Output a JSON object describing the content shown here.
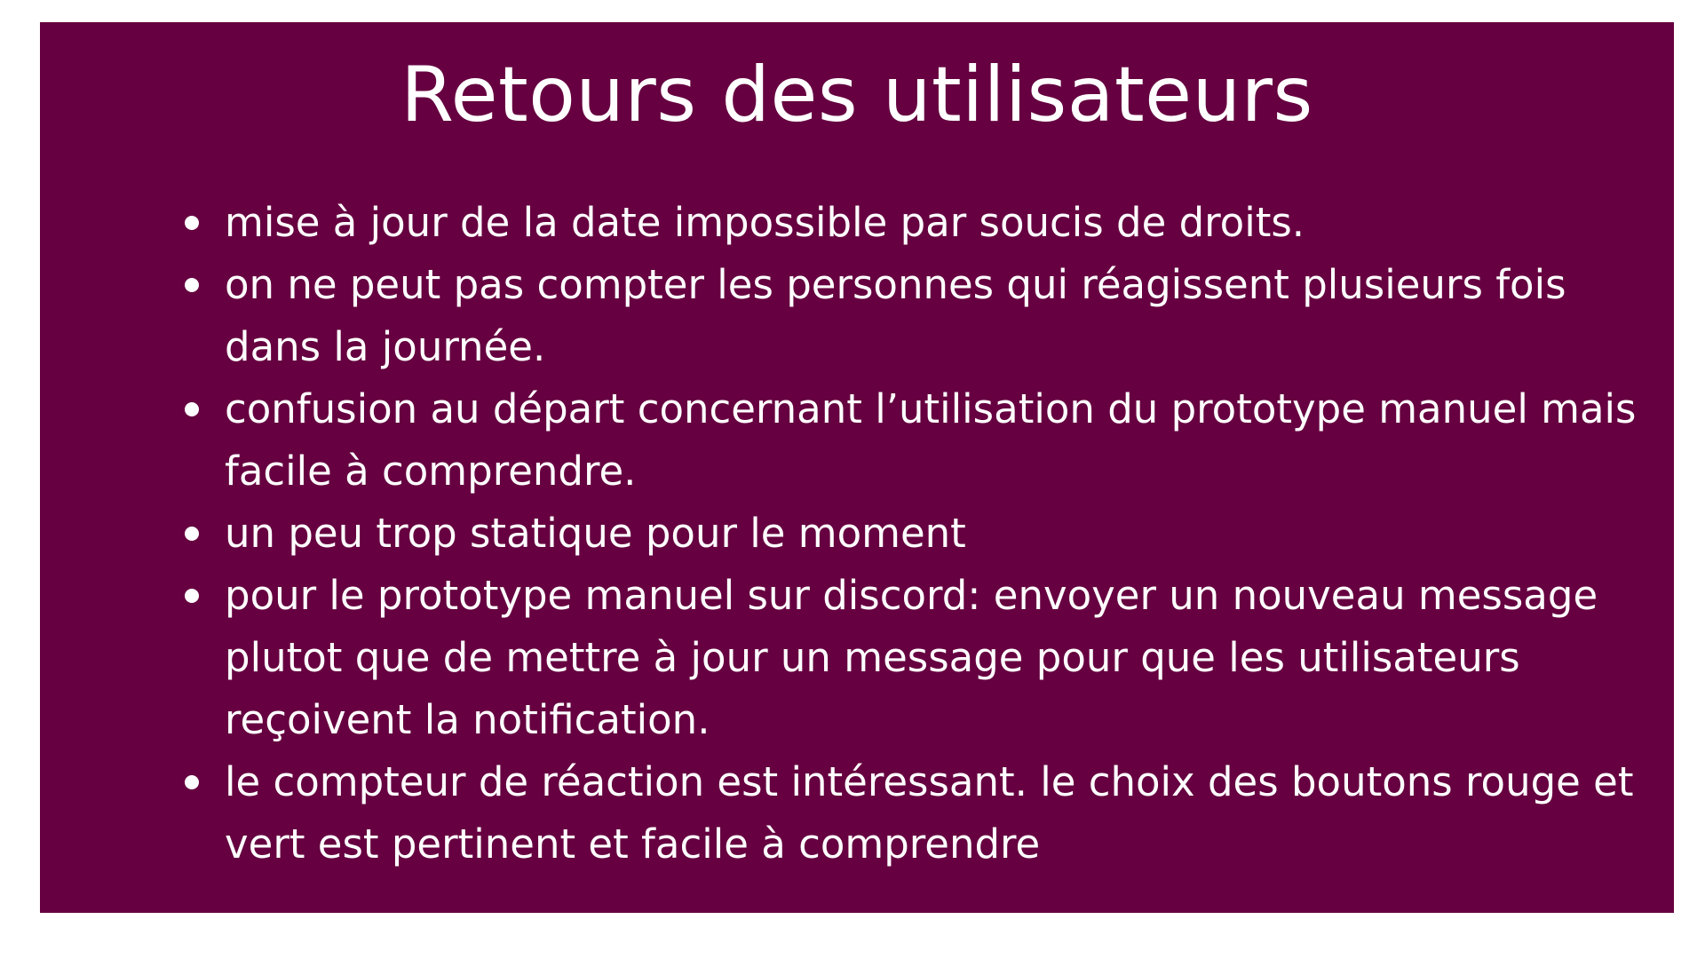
{
  "slide": {
    "background_color": "#660040",
    "text_color": "#ffffff",
    "title": "Retours des utilisateurs",
    "bullets": [
      "mise à jour de la date impossible par soucis de droits.",
      "on ne peut pas compter les personnes qui réagissent plusieurs fois dans la journée.",
      "confusion au départ concernant l’utilisation du prototype manuel mais facile à comprendre.",
      "un peu trop statique pour le moment",
      "pour le prototype manuel sur discord: envoyer un nouveau message plutot que de mettre à jour un message pour que les utilisateurs reçoivent la notification.",
      "le compteur de réaction est intéressant. le choix des boutons rouge et vert est pertinent et facile à comprendre"
    ]
  }
}
